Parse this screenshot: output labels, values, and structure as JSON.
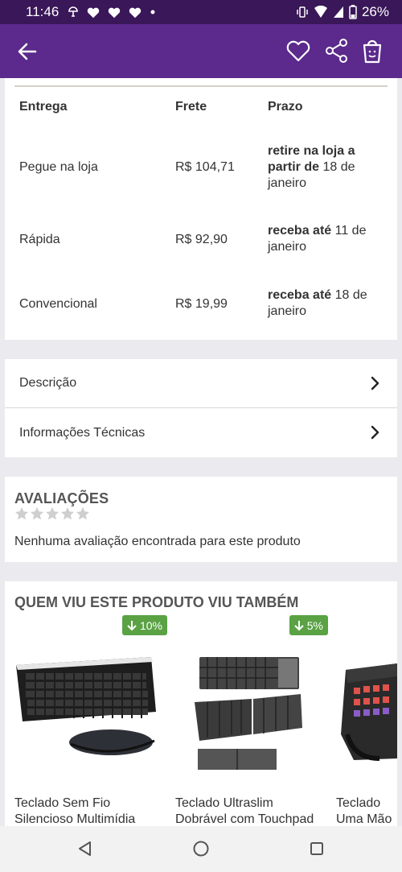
{
  "status_bar": {
    "time": "11:46",
    "battery": "26%"
  },
  "shipping": {
    "headers": {
      "method": "Entrega",
      "price": "Frete",
      "term": "Prazo"
    },
    "rows": [
      {
        "method": "Pegue na loja",
        "price": "R$ 104,71",
        "term_bold": "retire na loja a partir de",
        "term_rest": " 18 de janeiro"
      },
      {
        "method": "Rápida",
        "price": "R$ 92,90",
        "term_bold": "receba até",
        "term_rest": " 11 de janeiro"
      },
      {
        "method": "Convencional",
        "price": "R$ 19,99",
        "term_bold": "receba até",
        "term_rest": " 18 de janeiro"
      }
    ]
  },
  "sections": {
    "description": "Descrição",
    "tech_info": "Informações Técnicas"
  },
  "reviews": {
    "title": "AVALIAÇÕES",
    "empty_text": "Nenhuma avaliação encontrada para este produto",
    "rating": 0,
    "max_rating": 5
  },
  "recommendations": {
    "title": "QUEM VIU ESTE PRODUTO VIU TAMBÉM",
    "products": [
      {
        "discount": "10%",
        "name_line1": "Teclado Sem Fio",
        "name_line2": "Silencioso Multimídia"
      },
      {
        "discount": "5%",
        "name_line1": "Teclado Ultraslim",
        "name_line2": "Dobrável com Touchpad"
      },
      {
        "discount": "",
        "name_line1": "Teclado",
        "name_line2": "Uma Mão"
      }
    ]
  },
  "colors": {
    "status_bar": "#3a1758",
    "app_bar": "#5b2a8c",
    "badge_green": "#5aa244",
    "star_gray": "#cfcfcf"
  }
}
